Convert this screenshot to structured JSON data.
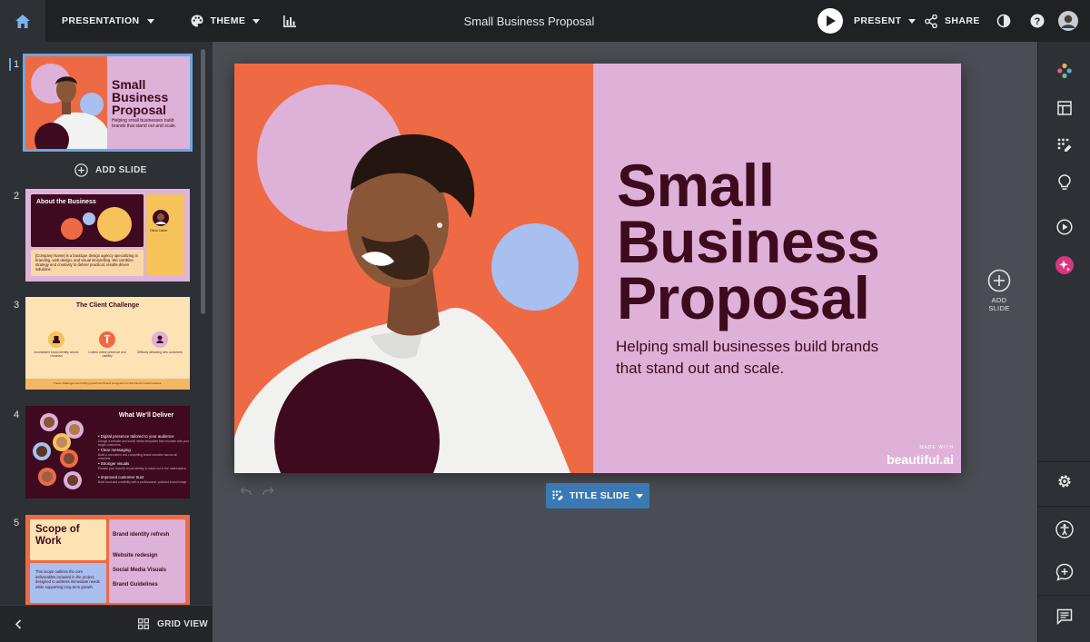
{
  "topbar": {
    "presentation_label": "PRESENTATION",
    "theme_label": "THEME",
    "title": "Small Business Proposal",
    "present_label": "PRESENT",
    "share_label": "SHARE"
  },
  "slides": [
    {
      "number": "1",
      "title_lines": [
        "Small",
        "Business",
        "Proposal"
      ],
      "subtitle": "Helping small businesses build brands that stand out and scale."
    },
    {
      "number": "2",
      "title": "About the Business",
      "body": "[Company Name] is a boutique design agency specializing in branding, web design, and visual storytelling. We combine strategy and creativity to deliver practical, results-driven solutions.",
      "person_name": "Olivia Carter"
    },
    {
      "number": "3",
      "title": "The Client Challenge",
      "captions": [
        "Inconsistent brand identity across channels",
        "Limited online presence and visibility",
        "Difficulty attracting new customers"
      ],
      "footer": "These challenges are limiting growth and brand recognition for the client's small business."
    },
    {
      "number": "4",
      "title": "What We'll Deliver",
      "items": [
        {
          "head": "Digital presence tailored to your audience",
          "sub": "Design a website and social media templates that resonate with your target customers."
        },
        {
          "head": "Clear messaging",
          "sub": "Build a consistent and compelling brand narrative across all channels."
        },
        {
          "head": "Stronger visuals",
          "sub": "Elevate your brand's visual identity to stand out in the marketplace."
        },
        {
          "head": "Improved customer trust",
          "sub": "Build trust and credibility with a professional, polished brand image."
        }
      ]
    },
    {
      "number": "5",
      "title": "Scope of Work",
      "body": "This scope outlines the core deliverables included in the project, designed to address immediate needs while supporting long-term growth.",
      "items": [
        "Brand identity refresh",
        "Website redesign",
        "Social Media Visuals",
        "Brand Guidelines"
      ]
    }
  ],
  "left_panel": {
    "add_slide_label": "ADD SLIDE",
    "grid_view_label": "GRID VIEW"
  },
  "main_slide": {
    "title_lines": [
      "Small",
      "Business",
      "Proposal"
    ],
    "subtitle_lines": [
      "Helping small businesses build brands",
      "that stand out and scale."
    ],
    "made_with": "MADE WITH",
    "brand": "beautiful.ai"
  },
  "canvas": {
    "add_slide_label": "ADD SLIDE",
    "layout_button_label": "TITLE SLIDE"
  },
  "colors": {
    "topbar": "#1f2124",
    "panel": "#2d3035",
    "canvas": "#4a4d53",
    "orange": "#ee6a44",
    "pink": "#dfb1d8",
    "maroon": "#3d0a1e",
    "blue_circle": "#a8bff0",
    "accent_blue": "#3b79b4"
  },
  "icons": {
    "topbar": [
      "home-icon",
      "palette-icon",
      "bar-chart-icon",
      "play-icon",
      "share-icon",
      "contrast-icon",
      "help-icon",
      "avatar"
    ],
    "right_rail": [
      "color-dots-icon",
      "layout-icon",
      "slide-edit-icon",
      "lightbulb-icon",
      "play-circle-icon",
      "ai-sparkle-icon",
      "settings-icon",
      "accessibility-icon",
      "add-comment-icon",
      "comments-icon"
    ]
  }
}
